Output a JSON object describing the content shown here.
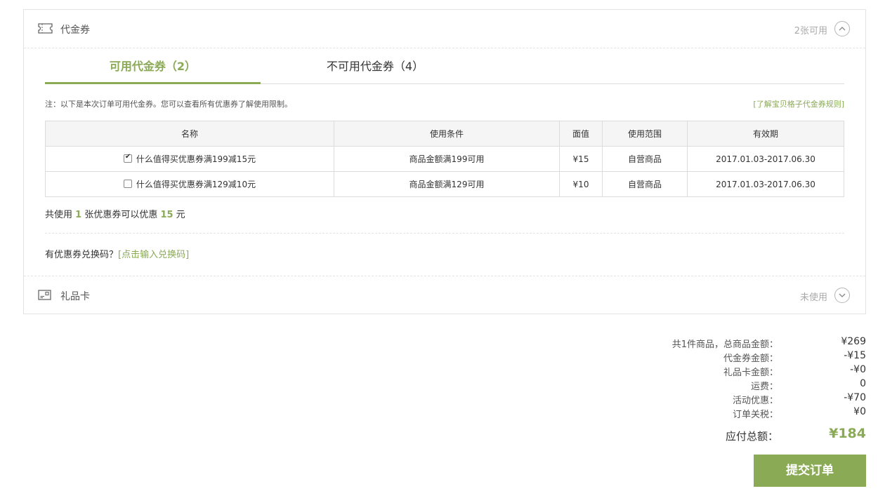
{
  "coupon_section": {
    "icon": "ticket-icon",
    "title": "代金券",
    "status": "2张可用",
    "toggle_icon": "chevron-up-icon"
  },
  "tabs": [
    {
      "label": "可用代金券（2）",
      "active": true
    },
    {
      "label": "不可用代金券（4）",
      "active": false
    }
  ],
  "note": "注：以下是本次订单可用代金券。您可以查看所有优惠券了解使用限制。",
  "rule_link": "[了解宝贝格子代金券规则]",
  "table": {
    "headers": [
      "名称",
      "使用条件",
      "面值",
      "使用范围",
      "有效期"
    ],
    "rows": [
      {
        "checked": true,
        "name": "什么值得买优惠券满199减15元",
        "condition": "商品金额满199可用",
        "value": "¥15",
        "scope": "自营商品",
        "validity": "2017.01.03-2017.06.30"
      },
      {
        "checked": false,
        "name": "什么值得买优惠券满129减10元",
        "condition": "商品金额满129可用",
        "value": "¥10",
        "scope": "自营商品",
        "validity": "2017.01.03-2017.06.30"
      }
    ]
  },
  "summary": {
    "prefix": "共使用 ",
    "count": "1",
    "middle": " 张优惠券可以优惠 ",
    "amount": "15",
    "suffix": " 元"
  },
  "exchange": {
    "text": "有优惠券兑换码？",
    "link": "[点击输入兑换码]"
  },
  "gift_section": {
    "icon": "gift-card-icon",
    "title": "礼品卡",
    "status": "未使用",
    "toggle_icon": "chevron-down-icon"
  },
  "totals": [
    {
      "label": "共1件商品，总商品金额：",
      "value": "¥269"
    },
    {
      "label": "代金券金额：",
      "value": "-¥15"
    },
    {
      "label": "礼品卡金额：",
      "value": "-¥0"
    },
    {
      "label": "运费：",
      "value": "0"
    },
    {
      "label": "活动优惠：",
      "value": "-¥70"
    },
    {
      "label": "订单关税：",
      "value": "¥0"
    }
  ],
  "grand_total": {
    "label": "应付总额：",
    "value": "¥184"
  },
  "submit_label": "提交订单",
  "colors": {
    "accent": "#8aaa56",
    "border": "#e3e3e3"
  }
}
